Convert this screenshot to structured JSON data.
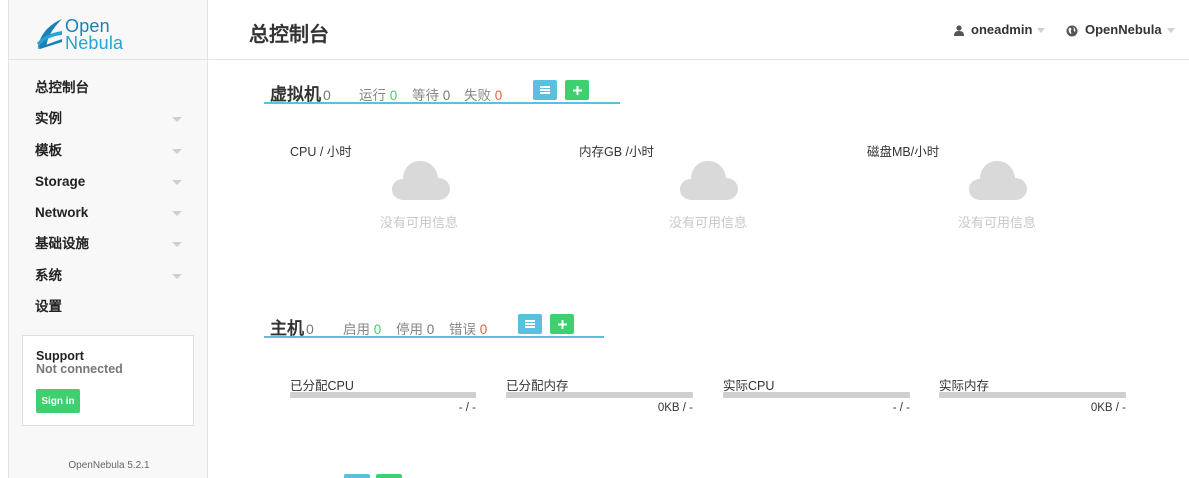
{
  "app": {
    "logo_line1": "Open",
    "logo_line2": "Nebula",
    "version": "OpenNebula 5.2.1"
  },
  "header": {
    "title": "总控制台",
    "user": "oneadmin",
    "zone": "OpenNebula"
  },
  "sidebar": {
    "items": [
      {
        "label": "总控制台",
        "has_caret": false
      },
      {
        "label": "实例",
        "has_caret": true
      },
      {
        "label": "模板",
        "has_caret": true
      },
      {
        "label": "Storage",
        "has_caret": true
      },
      {
        "label": "Network",
        "has_caret": true
      },
      {
        "label": "基础设施",
        "has_caret": true
      },
      {
        "label": "系统",
        "has_caret": true
      },
      {
        "label": "设置",
        "has_caret": false
      }
    ],
    "support": {
      "title": "Support",
      "status": "Not connected",
      "signin_label": "Sign in"
    }
  },
  "vms": {
    "title": "虚拟机",
    "count": "0",
    "running_label": "运行",
    "running": "0",
    "pending_label": "等待",
    "pending": "0",
    "failed_label": "失败",
    "failed": "0",
    "charts": [
      {
        "label": "CPU / 小时",
        "empty": "没有可用信息"
      },
      {
        "label": "内存GB /小时",
        "empty": "没有可用信息"
      },
      {
        "label": "磁盘MB/小时",
        "empty": "没有可用信息"
      }
    ]
  },
  "hosts": {
    "title": "主机",
    "count": "0",
    "on_label": "启用",
    "on": "0",
    "off_label": "停用",
    "off": "0",
    "error_label": "错误",
    "error": "0",
    "meters": [
      {
        "label": "已分配CPU",
        "value": "- / -",
        "fill": 0
      },
      {
        "label": "已分配内存",
        "value": "0KB / -",
        "fill": 0
      },
      {
        "label": "实际CPU",
        "value": "- / -",
        "fill": 0
      },
      {
        "label": "实际内存",
        "value": "0KB / -",
        "fill": 0
      }
    ]
  },
  "colors": {
    "accent_blue": "#5bc0de",
    "accent_green": "#3ecf6e",
    "error_red": "#e65d3a"
  }
}
